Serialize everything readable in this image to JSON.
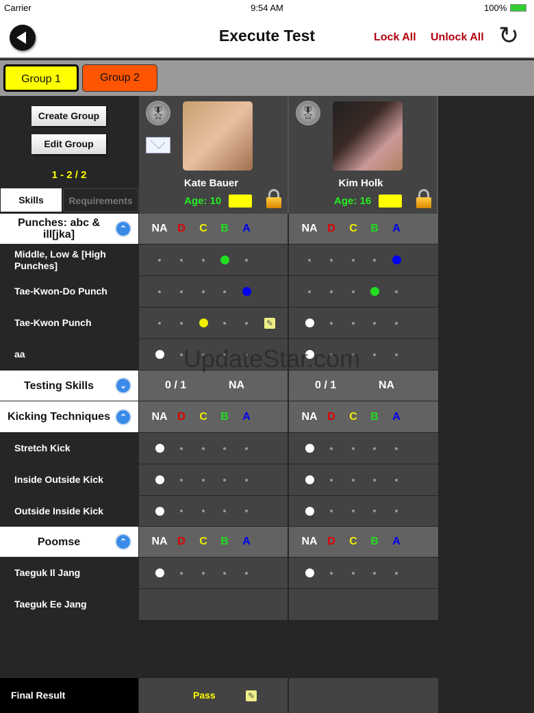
{
  "status": {
    "carrier": "Carrier",
    "time": "9:54 AM",
    "battery": "100%"
  },
  "nav": {
    "title": "Execute Test",
    "lock_all": "Lock All",
    "unlock_all": "Unlock All"
  },
  "groups": [
    {
      "label": "Group 1",
      "color": "#ffff00",
      "selected": true
    },
    {
      "label": "Group 2",
      "color": "#ff5500",
      "selected": false
    }
  ],
  "left": {
    "create_group": "Create Group",
    "edit_group": "Edit Group",
    "pager": "1 - 2 / 2",
    "tab_skills": "Skills",
    "tab_requirements": "Requirements"
  },
  "students": [
    {
      "name": "Kate Bauer",
      "age": "Age: 10",
      "has_mail": true
    },
    {
      "name": "Kim Holk",
      "age": "Age: 16",
      "has_mail": false
    }
  ],
  "grades": [
    "NA",
    "D",
    "C",
    "B",
    "A"
  ],
  "grade_colors": [
    "#ffffff",
    "#e00000",
    "#f0f000",
    "#22dd22",
    "#0000ee"
  ],
  "rows": [
    {
      "type": "section",
      "label": "Punches: abc & ill[jka]"
    },
    {
      "type": "skill",
      "label": "Middle, Low & [High Punches]",
      "values": [
        3,
        4
      ],
      "edit": [
        false,
        false
      ]
    },
    {
      "type": "skill",
      "label": "Tae-Kwon-Do Punch",
      "values": [
        4,
        3
      ],
      "edit": [
        false,
        false
      ]
    },
    {
      "type": "skill",
      "label": "Tae-Kwon Punch",
      "values": [
        2,
        0
      ],
      "edit": [
        true,
        false
      ]
    },
    {
      "type": "skill",
      "label": "aa",
      "values": [
        0,
        0
      ],
      "edit": [
        false,
        false
      ]
    },
    {
      "type": "summary",
      "label": "Testing Skills",
      "cells": [
        [
          "0 / 1",
          "NA"
        ],
        [
          "0 / 1",
          "NA"
        ]
      ]
    },
    {
      "type": "section",
      "label": "Kicking Techniques"
    },
    {
      "type": "skill",
      "label": "Stretch Kick",
      "values": [
        0,
        0
      ],
      "edit": [
        false,
        false
      ]
    },
    {
      "type": "skill",
      "label": "Inside Outside Kick",
      "values": [
        0,
        0
      ],
      "edit": [
        false,
        false
      ]
    },
    {
      "type": "skill",
      "label": "Outside Inside Kick",
      "values": [
        0,
        0
      ],
      "edit": [
        false,
        false
      ]
    },
    {
      "type": "section",
      "label": "Poomse"
    },
    {
      "type": "skill",
      "label": "Taeguk Il Jang",
      "values": [
        0,
        0
      ],
      "edit": [
        false,
        false
      ]
    },
    {
      "type": "empty",
      "label": "Taeguk Ee Jang"
    }
  ],
  "final": {
    "label": "Final Result",
    "results": [
      "Pass",
      ""
    ]
  },
  "watermark": "UpdateStar.com"
}
